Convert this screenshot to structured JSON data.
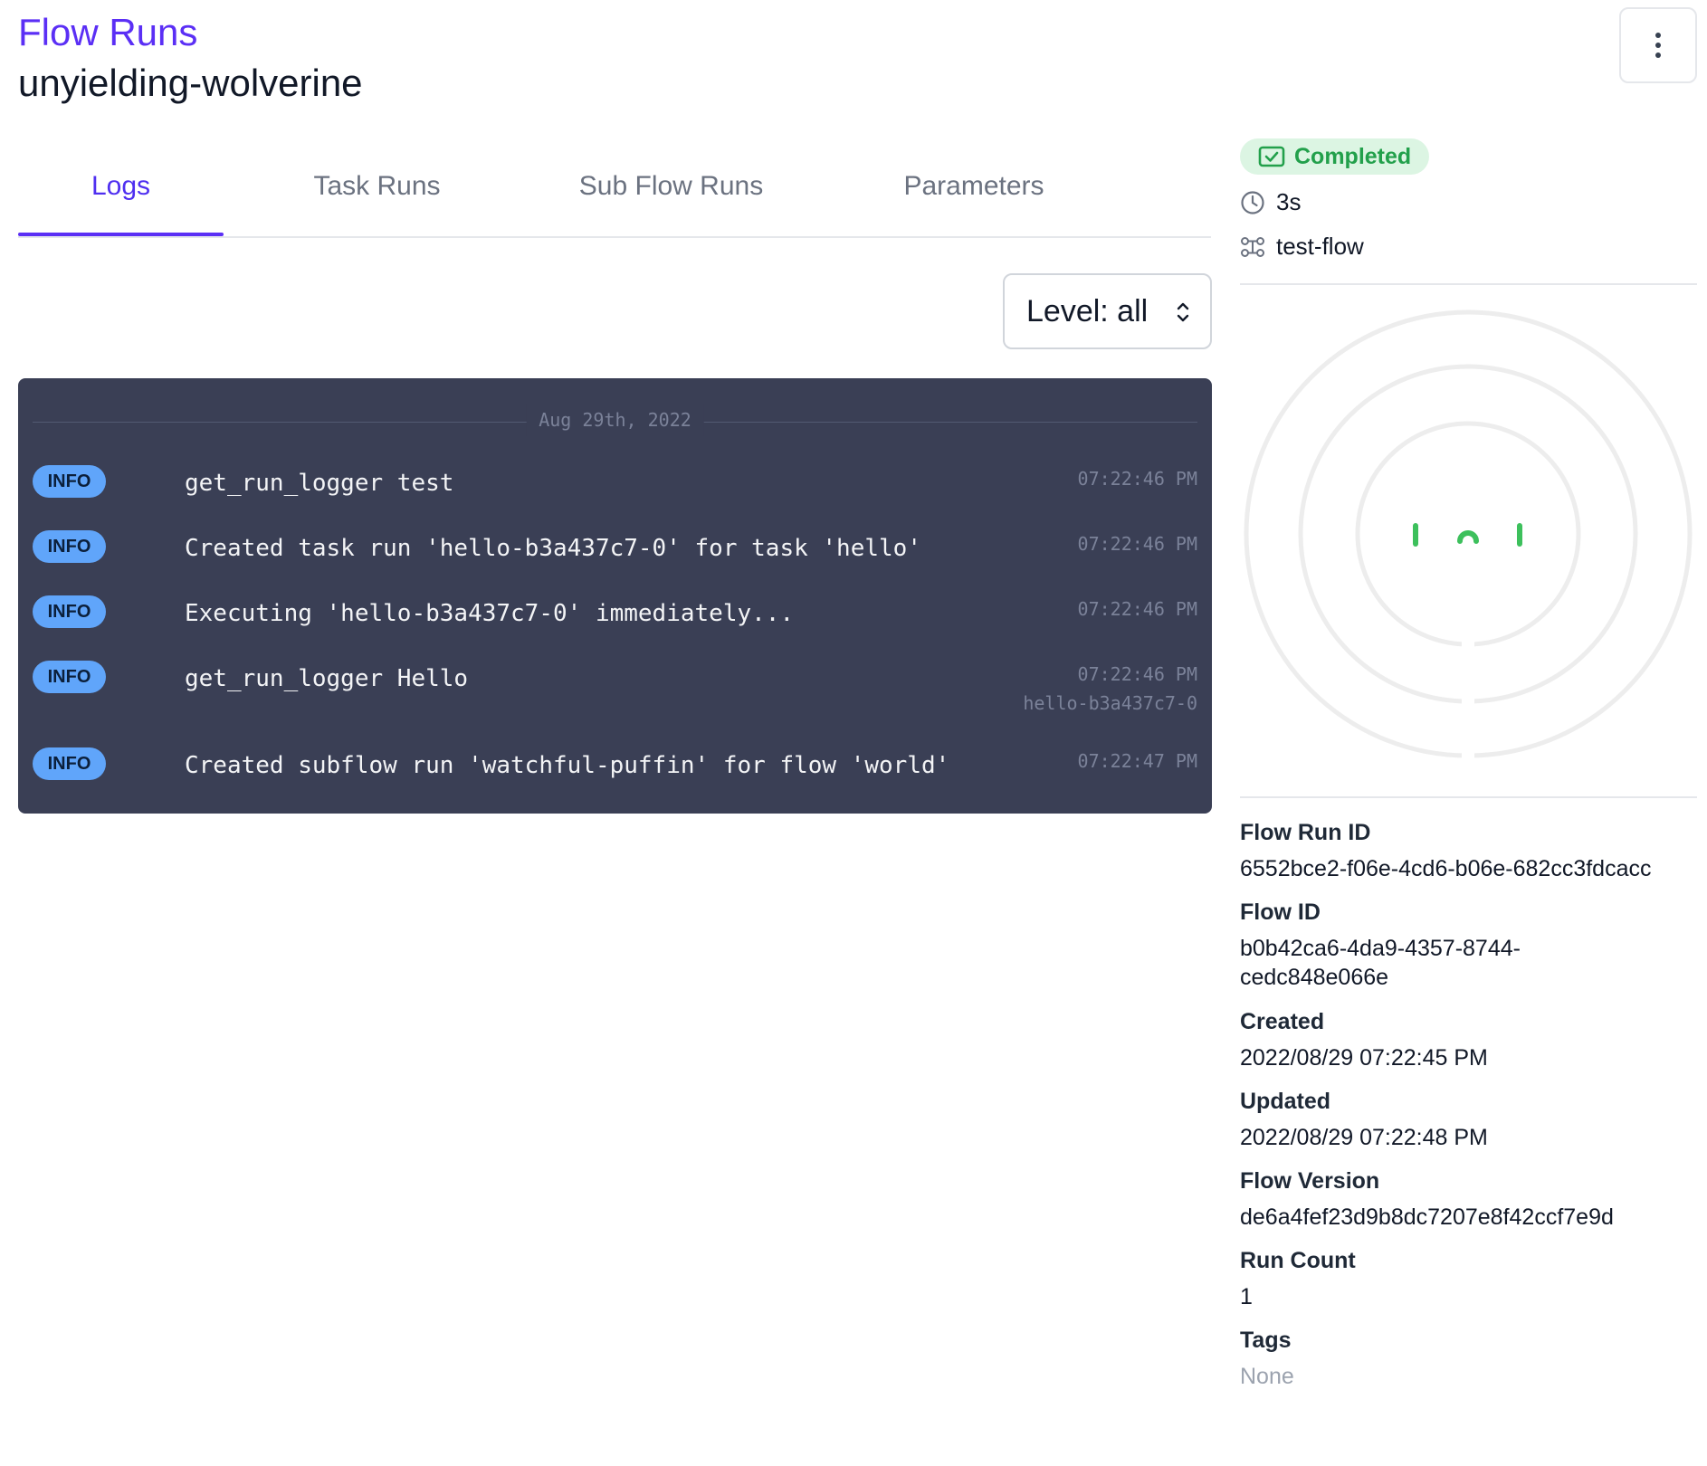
{
  "header": {
    "breadcrumb": "Flow Runs",
    "title": "unyielding-wolverine"
  },
  "tabs": [
    {
      "label": "Logs",
      "active": true
    },
    {
      "label": "Task Runs",
      "active": false
    },
    {
      "label": "Sub Flow Runs",
      "active": false
    },
    {
      "label": "Parameters",
      "active": false
    }
  ],
  "logs": {
    "level_filter": "Level: all",
    "date": "Aug 29th, 2022",
    "entries": [
      {
        "level": "INFO",
        "message": "get_run_logger test",
        "time": "07:22:46 PM",
        "task": ""
      },
      {
        "level": "INFO",
        "message": "Created task run 'hello-b3a437c7-0' for task 'hello'",
        "time": "07:22:46 PM",
        "task": ""
      },
      {
        "level": "INFO",
        "message": "Executing 'hello-b3a437c7-0' immediately...",
        "time": "07:22:46 PM",
        "task": ""
      },
      {
        "level": "INFO",
        "message": "get_run_logger Hello",
        "time": "07:22:46 PM",
        "task": "hello-b3a437c7-0"
      },
      {
        "level": "INFO",
        "message": "Created subflow run 'watchful-puffin' for flow 'world'",
        "time": "07:22:47 PM",
        "task": ""
      }
    ]
  },
  "sidebar": {
    "status": "Completed",
    "duration": "3s",
    "flow_name": "test-flow",
    "details": [
      {
        "label": "Flow Run ID",
        "value": "6552bce2-f06e-4cd6-b06e-682cc3fdcacc"
      },
      {
        "label": "Flow ID",
        "value": "b0b42ca6-4da9-4357-8744-cedc848e066e"
      },
      {
        "label": "Created",
        "value": "2022/08/29 07:22:45 PM"
      },
      {
        "label": "Updated",
        "value": "2022/08/29 07:22:48 PM"
      },
      {
        "label": "Flow Version",
        "value": "de6a4fef23d9b8dc7207e8f42ccf7e9d"
      },
      {
        "label": "Run Count",
        "value": "1"
      },
      {
        "label": "Tags",
        "value": "None"
      }
    ]
  },
  "colors": {
    "accent": "#5b2ff5",
    "log_bg": "#3a3f55",
    "info_badge": "#60a5fa",
    "completed": "#22a04b"
  }
}
